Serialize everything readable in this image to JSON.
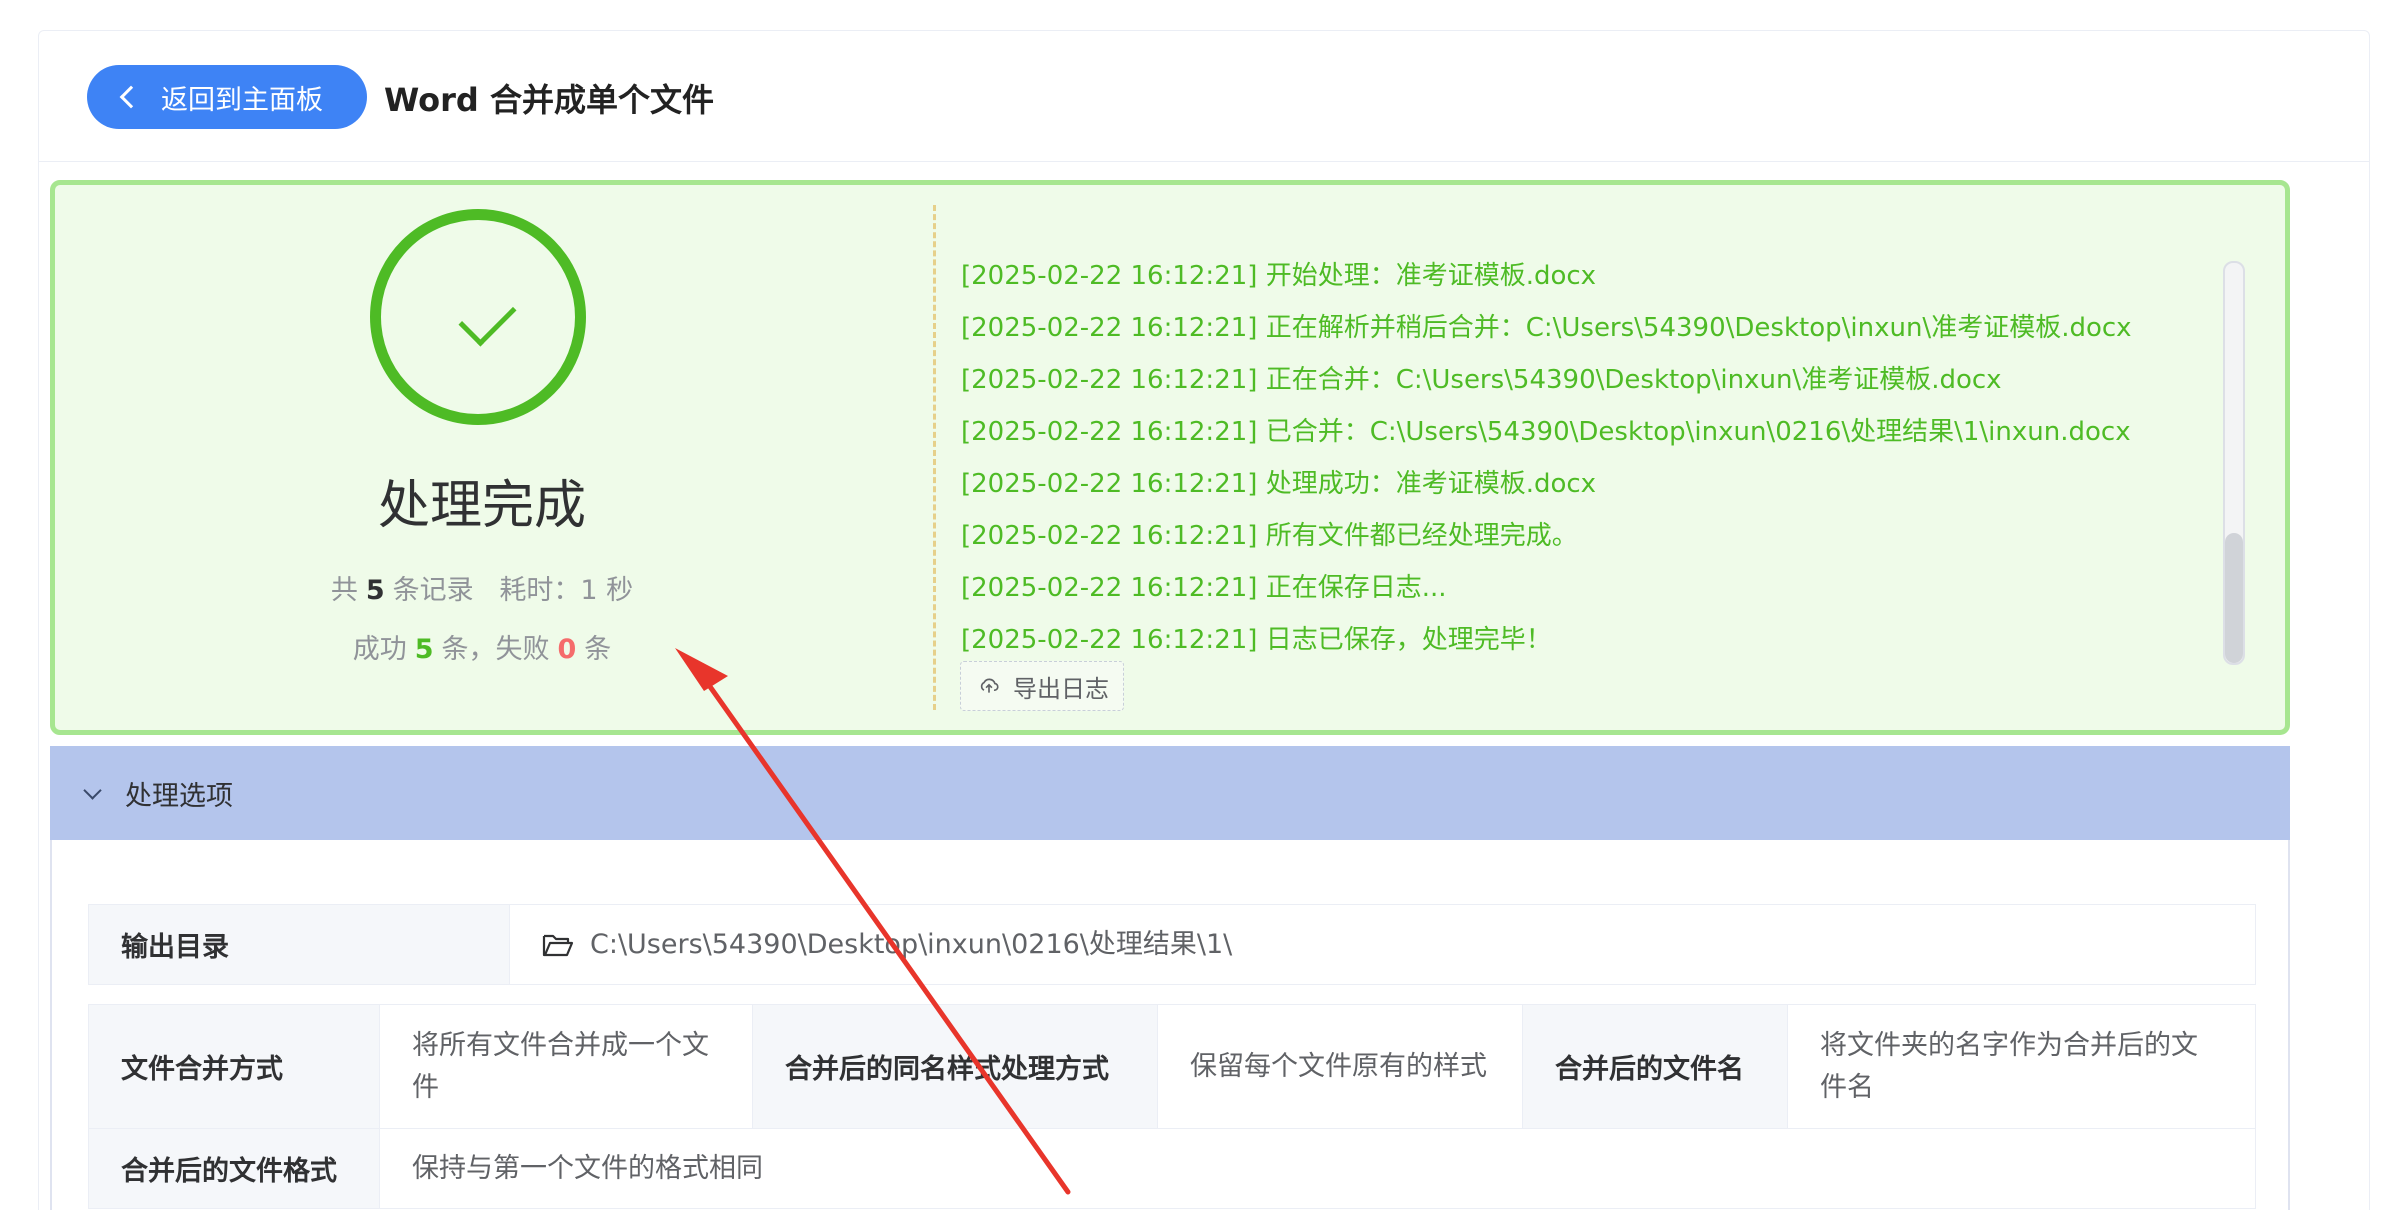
{
  "header": {
    "back_label": "返回到主面板",
    "title": "Word 合并成单个文件"
  },
  "result": {
    "status": "处理完成",
    "total_prefix": "共",
    "total_count": "5",
    "total_suffix": "条记录",
    "elapsed": "耗时：1 秒",
    "success_prefix": "成功",
    "success_count": "5",
    "success_mid": "条，失败",
    "fail_count": "0",
    "fail_suffix": "条",
    "accent_color": "#4ebb25",
    "fail_color": "#f56c6c"
  },
  "log": {
    "lines": [
      "[2025-02-22 16:12:21] 开始处理：准考证模板.docx",
      "[2025-02-22 16:12:21] 正在解析并稍后合并：C:\\Users\\54390\\Desktop\\inxun\\准考证模板.docx",
      "[2025-02-22 16:12:21] 正在合并：C:\\Users\\54390\\Desktop\\inxun\\准考证模板.docx",
      "[2025-02-22 16:12:21] 已合并：C:\\Users\\54390\\Desktop\\inxun\\0216\\处理结果\\1\\inxun.docx",
      "[2025-02-22 16:12:21] 处理成功：准考证模板.docx",
      "[2025-02-22 16:12:21] 所有文件都已经处理完成。",
      "[2025-02-22 16:12:21] 正在保存日志...",
      "[2025-02-22 16:12:21] 日志已保存，处理完毕！"
    ],
    "export_label": "导出日志",
    "export_icon": "cloud-upload-icon"
  },
  "options": {
    "section_label": "处理选项",
    "output_dir_label": "输出目录",
    "output_dir_value": "C:\\Users\\54390\\Desktop\\inxun\\0216\\处理结果\\1\\",
    "merge_mode_label": "文件合并方式",
    "merge_mode_value": "将所有文件合并成一个文件",
    "style_label": "合并后的同名样式处理方式",
    "style_value": "保留每个文件原有的样式",
    "filename_label": "合并后的文件名",
    "filename_value": "将文件夹的名字作为合并后的文件名",
    "format_label": "合并后的文件格式",
    "format_value": "保持与第一个文件的格式相同"
  }
}
